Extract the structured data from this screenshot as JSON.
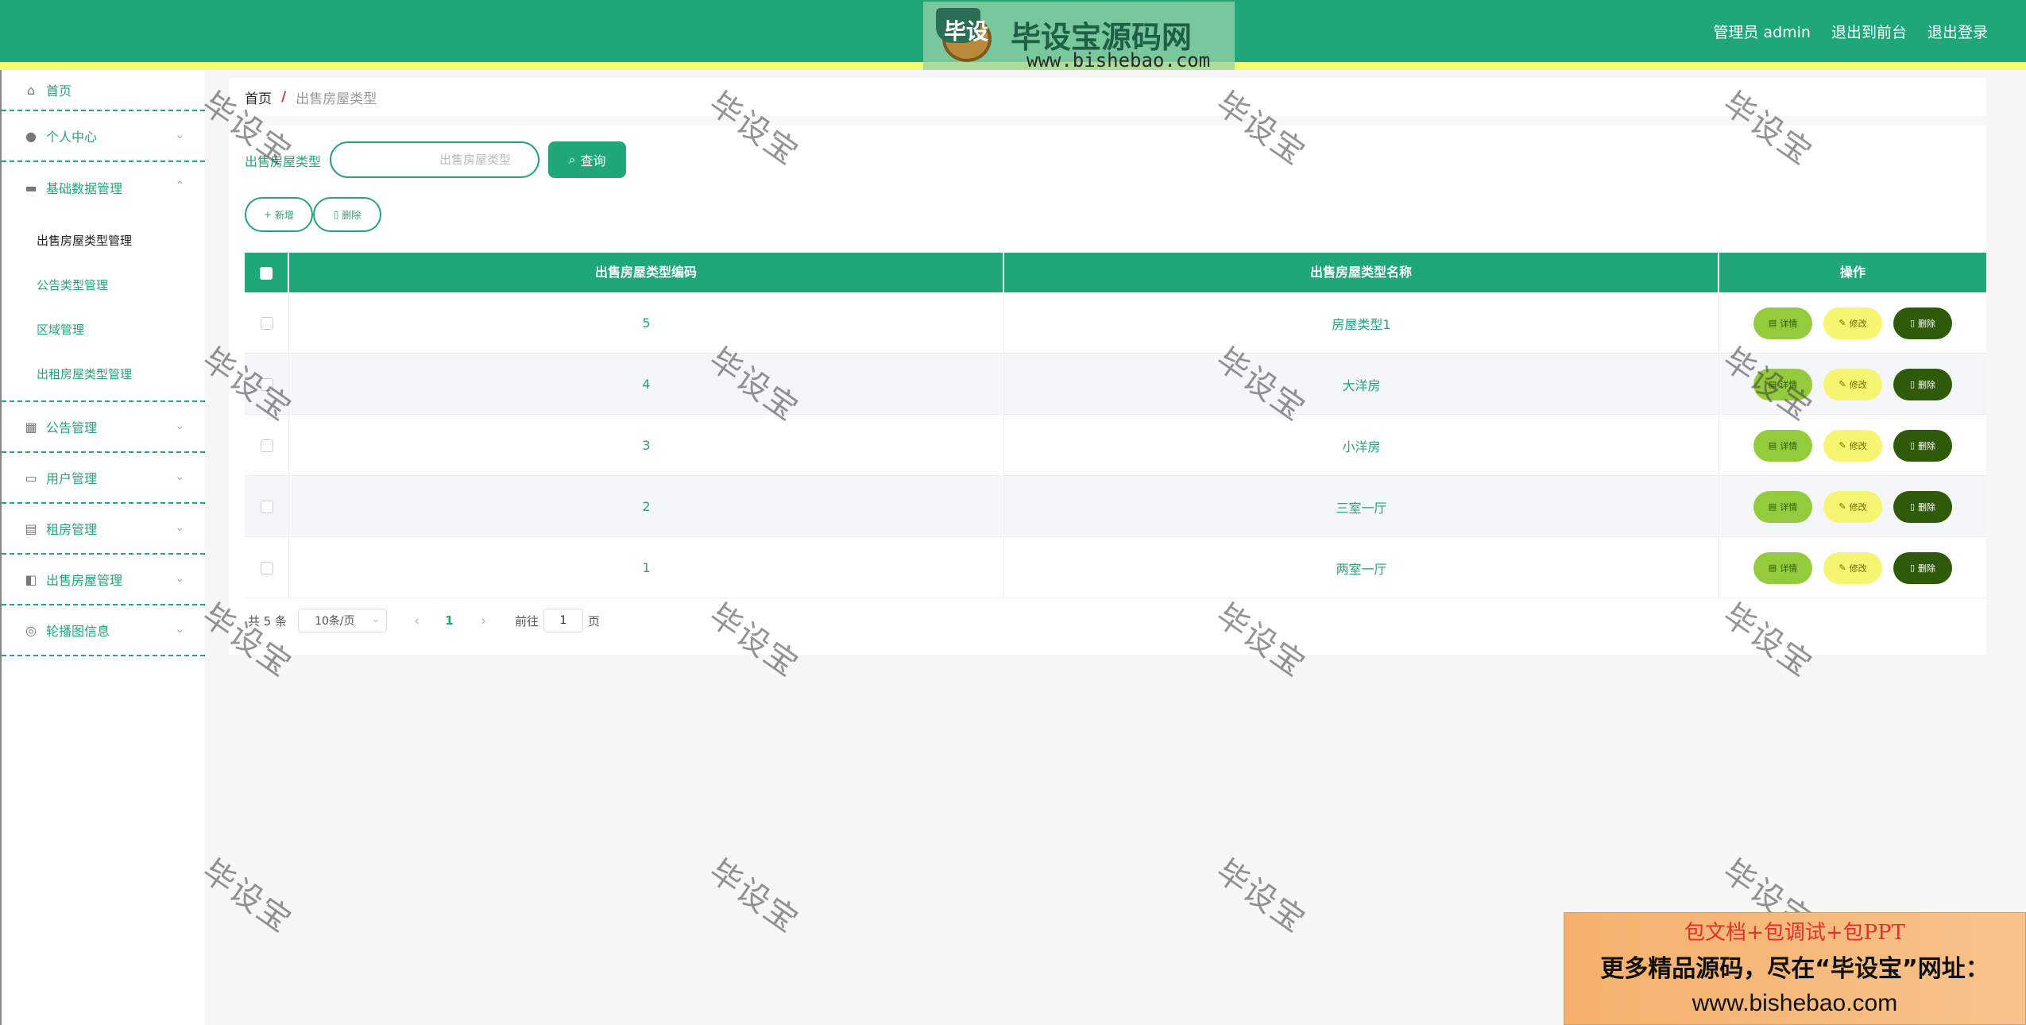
{
  "header": {
    "user_label": "管理员 admin",
    "to_front_label": "退出到前台",
    "logout_label": "退出登录",
    "logo": {
      "badge": "毕设",
      "title": "毕设宝源码网",
      "url": "www.bishebao.com"
    },
    "color": "#20a779",
    "stripe_color": "#f4fb6e"
  },
  "sidebar": {
    "items": [
      {
        "label": "首页",
        "icon": "home-icon"
      },
      {
        "label": "个人中心",
        "icon": "user-icon"
      },
      {
        "label": "基础数据管理",
        "icon": "monitor-icon"
      },
      {
        "label": "公告管理",
        "icon": "grid-icon"
      },
      {
        "label": "用户管理",
        "icon": "id-card-icon"
      },
      {
        "label": "租房管理",
        "icon": "clipboard-icon"
      },
      {
        "label": "出售房屋管理",
        "icon": "ticket-icon"
      },
      {
        "label": "轮播图信息",
        "icon": "target-icon"
      }
    ],
    "subitems": [
      {
        "label": "出售房屋类型管理",
        "active": true
      },
      {
        "label": "公告类型管理"
      },
      {
        "label": "区域管理"
      },
      {
        "label": "出租房屋类型管理"
      }
    ]
  },
  "breadcrumb": {
    "home": "首页",
    "sep": "/",
    "current": "出售房屋类型"
  },
  "search": {
    "label": "出售房屋类型",
    "placeholder": "出售房屋类型",
    "button": "查询"
  },
  "actions": {
    "add": "新增",
    "delete": "删除"
  },
  "table": {
    "headers": [
      "出售房屋类型编码",
      "出售房屋类型名称",
      "操作"
    ],
    "rows": [
      {
        "code": "5",
        "name": "房屋类型1"
      },
      {
        "code": "4",
        "name": "大洋房"
      },
      {
        "code": "3",
        "name": "小洋房"
      },
      {
        "code": "2",
        "name": "三室一厅"
      },
      {
        "code": "1",
        "name": "两室一厅"
      }
    ],
    "op_labels": {
      "detail": "详情",
      "edit": "修改",
      "delete": "删除"
    }
  },
  "pagination": {
    "total": "共 5 条",
    "page_size": "10条/页",
    "current_page": "1",
    "goto_prefix": "前往",
    "goto_value": "1",
    "goto_suffix": "页"
  },
  "watermark": "毕设宝",
  "promo": {
    "line1": "包文档+包调试+包PPT",
    "line2": "更多精品源码，尽在“毕设宝”网址：",
    "line3": "www.bishebao.com"
  }
}
